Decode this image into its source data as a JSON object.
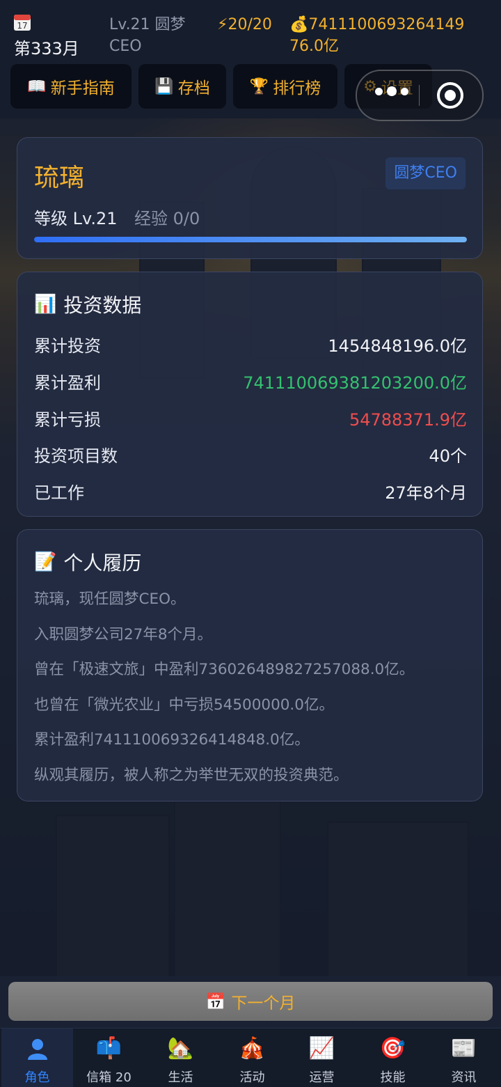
{
  "header": {
    "month_label": "第333月",
    "level_role": "Lv.21 圆梦CEO",
    "energy": "⚡20/20",
    "money": "💰741110069326414976.0亿"
  },
  "toolbar": {
    "guide_label": "新手指南",
    "save_label": "存档",
    "rank_label": "排行榜",
    "settings_label": "设置"
  },
  "profile": {
    "name": "琉璃",
    "role_badge": "圆梦CEO",
    "level_text": "等级 Lv.21",
    "exp_text": "经验 0/0",
    "exp_progress": 1.0
  },
  "investment": {
    "title": "投资数据",
    "rows": [
      {
        "key": "累计投资",
        "value": "1454848196.0亿"
      },
      {
        "key": "累计盈利",
        "value": "741110069381203200.0亿"
      },
      {
        "key": "累计亏损",
        "value": "54788371.9亿"
      },
      {
        "key": "投资项目数",
        "value": "40个"
      },
      {
        "key": "已工作",
        "value": "27年8个月"
      }
    ]
  },
  "resume": {
    "title": "个人履历",
    "lines": [
      "琉璃，现任圆梦CEO。",
      "入职圆梦公司27年8个月。",
      "曾在「极速文旅」中盈利736026489827257088.0亿。",
      "也曾在「微光农业」中亏损54500000.0亿。",
      "累计盈利741110069326414848.0亿。",
      "纵观其履历，被人称之为举世无双的投资典范。"
    ]
  },
  "next_month_label": "下一个月",
  "tabs": [
    {
      "label": "角色",
      "icon": "person-icon",
      "active": true
    },
    {
      "label": "信箱 20",
      "icon": "mailbox-icon"
    },
    {
      "label": "生活",
      "icon": "house-icon"
    },
    {
      "label": "活动",
      "icon": "circus-tent-icon"
    },
    {
      "label": "运营",
      "icon": "chart-up-icon"
    },
    {
      "label": "技能",
      "icon": "target-icon"
    },
    {
      "label": "资讯",
      "icon": "newspaper-icon"
    }
  ],
  "colors": {
    "accent_gold": "#f3b12e",
    "profit_green": "#34c16f",
    "loss_red": "#ef4d4d",
    "active_blue": "#2f84ff"
  }
}
